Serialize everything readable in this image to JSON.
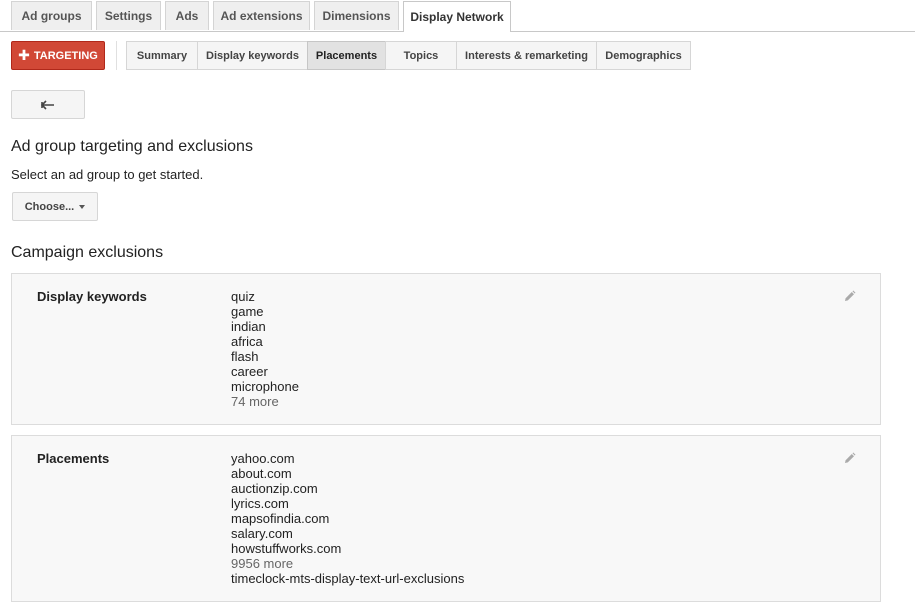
{
  "tabs": [
    {
      "label": "Ad groups"
    },
    {
      "label": "Settings"
    },
    {
      "label": "Ads"
    },
    {
      "label": "Ad extensions"
    },
    {
      "label": "Dimensions"
    },
    {
      "label": "Display Network",
      "active": true
    }
  ],
  "targeting_button": {
    "label": "TARGETING"
  },
  "subtabs": [
    {
      "label": "Summary"
    },
    {
      "label": "Display keywords"
    },
    {
      "label": "Placements",
      "active": true
    },
    {
      "label": "Topics"
    },
    {
      "label": "Interests & remarketing"
    },
    {
      "label": "Demographics"
    }
  ],
  "ad_group_section": {
    "title": "Ad group targeting and exclusions",
    "prompt": "Select an ad group to get started.",
    "choose_label": "Choose..."
  },
  "campaign_exclusions": {
    "title": "Campaign exclusions",
    "display_keywords": {
      "label": "Display keywords",
      "items": [
        "quiz",
        "game",
        "indian",
        "africa",
        "flash",
        "career",
        "microphone"
      ],
      "more": "74 more"
    },
    "placements": {
      "label": "Placements",
      "items": [
        "yahoo.com",
        "about.com",
        "auctionzip.com",
        "lyrics.com",
        "mapsofindia.com",
        "salary.com",
        "howstuffworks.com"
      ],
      "more": "9956 more",
      "extra": "timeclock-mts-display-text-url-exclusions"
    }
  },
  "colors": {
    "targeting_red": "#d14836",
    "button_gray": "#f5f5f5",
    "active_subtab": "#e2e2e2"
  }
}
